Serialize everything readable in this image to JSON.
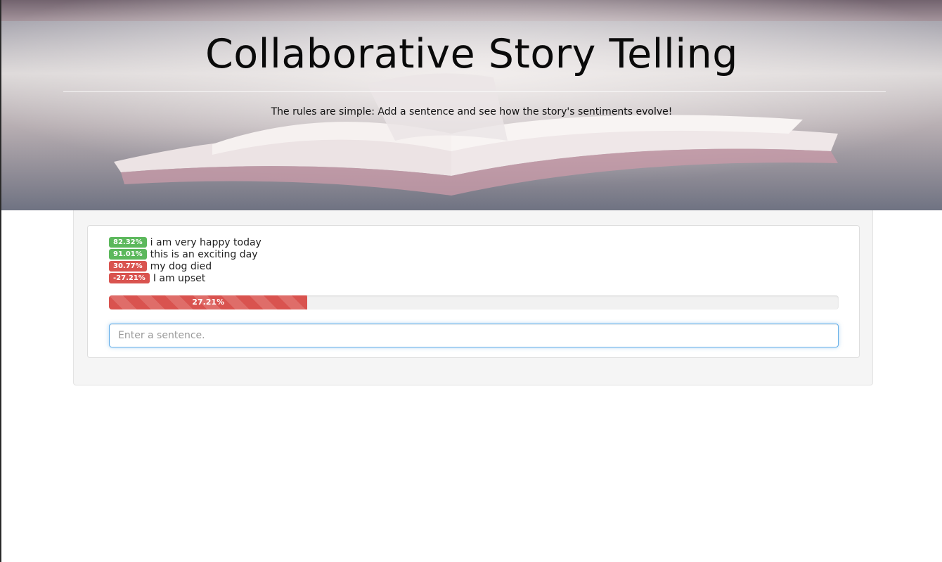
{
  "header": {
    "title": "Collaborative Story Telling",
    "subtitle": "The rules are simple: Add a sentence and see how the story's sentiments evolve!"
  },
  "story": {
    "sentences": [
      {
        "score": "82.32%",
        "text": "i am very happy today",
        "sentiment": "positive"
      },
      {
        "score": "91.01%",
        "text": "this is an exciting day",
        "sentiment": "positive"
      },
      {
        "score": "30.77%",
        "text": "my dog died",
        "sentiment": "negative"
      },
      {
        "score": "-27.21%",
        "text": "I am upset",
        "sentiment": "negative"
      }
    ],
    "progress": {
      "label": "27.21%",
      "value_percent": 27.21,
      "color": "#d9534f"
    }
  },
  "input": {
    "value": "",
    "placeholder": "Enter a sentence."
  },
  "colors": {
    "positive": "#5cb85c",
    "negative": "#d9534f",
    "focus": "#66afe9"
  }
}
